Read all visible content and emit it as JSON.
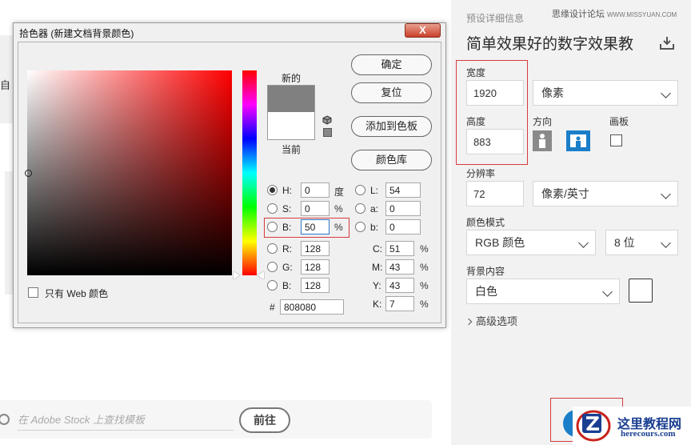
{
  "background_page": {
    "left_card_text": "自",
    "search": {
      "placeholder": "在 Adobe Stock 上查找模板"
    },
    "goto_label": "前往"
  },
  "right_panel": {
    "details_label": "预设详细信息",
    "watermark_cn": "思缘设计论坛",
    "watermark_site": "WWW.MISSYUAN.COM",
    "document_name": "简单效果好的数字效果教",
    "width": {
      "label": "宽度",
      "value": "1920",
      "unit": "像素"
    },
    "height": {
      "label": "高度",
      "value": "883"
    },
    "orientation_label": "方向",
    "artboard_label": "画板",
    "resolution": {
      "label": "分辨率",
      "value": "72",
      "unit": "像素/英寸"
    },
    "color_mode": {
      "label": "颜色模式",
      "value": "RGB 颜色",
      "bit_depth": "8 位"
    },
    "background": {
      "label": "背景内容",
      "value": "白色",
      "swatch_color": "#ffffff"
    },
    "advanced_label": "高级选项",
    "accent_color": "#1b7ec9",
    "logo": {
      "cn": "这里教程网",
      "en": "herecours.com"
    }
  },
  "color_picker": {
    "title": "拾色器 (新建文档背景颜色)",
    "close_label": "X",
    "new_label": "新的",
    "current_label": "当前",
    "new_color": "#808080",
    "current_color": "#ffffff",
    "buttons": {
      "ok": "确定",
      "reset": "复位",
      "add_to_swatches": "添加到色板",
      "color_libraries": "颜色库"
    },
    "hsb": {
      "h": {
        "label": "H:",
        "value": "0",
        "unit": "度"
      },
      "s": {
        "label": "S:",
        "value": "0",
        "unit": "%"
      },
      "b": {
        "label": "B:",
        "value": "50",
        "unit": "%"
      }
    },
    "rgb": {
      "r": {
        "label": "R:",
        "value": "128"
      },
      "g": {
        "label": "G:",
        "value": "128"
      },
      "b": {
        "label": "B:",
        "value": "128"
      }
    },
    "lab": {
      "l": {
        "label": "L:",
        "value": "54"
      },
      "a": {
        "label": "a:",
        "value": "0"
      },
      "b": {
        "label": "b:",
        "value": "0"
      }
    },
    "cmyk": {
      "c": {
        "label": "C:",
        "value": "51",
        "unit": "%"
      },
      "m": {
        "label": "M:",
        "value": "43",
        "unit": "%"
      },
      "y": {
        "label": "Y:",
        "value": "43",
        "unit": "%"
      },
      "k": {
        "label": "K:",
        "value": "7",
        "unit": "%"
      }
    },
    "hex": {
      "label": "#",
      "value": "808080"
    },
    "web_only_label": "只有 Web 颜色",
    "highlight_color": "#d63b3b"
  }
}
